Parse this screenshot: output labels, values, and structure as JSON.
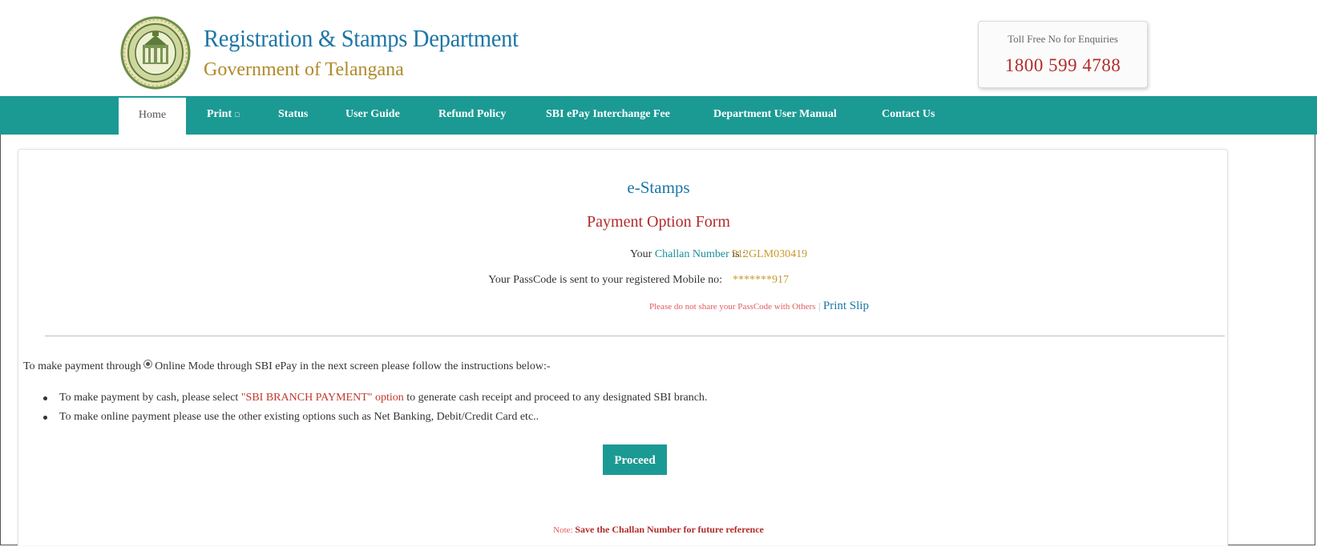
{
  "header": {
    "title": "Registration & Stamps Department",
    "subtitle": "Government of Telangana",
    "toll_label": "Toll Free No for Enquiries",
    "toll_number": "1800 599 4788",
    "logo_icon": "telangana-emblem-icon"
  },
  "nav": {
    "items": [
      {
        "label": "Home"
      },
      {
        "label": "Print",
        "caret": "□"
      },
      {
        "label": "Status"
      },
      {
        "label": "User Guide"
      },
      {
        "label": "Refund Policy"
      },
      {
        "label": "SBI ePay Interchange Fee"
      },
      {
        "label": "Department User Manual"
      },
      {
        "label": "Contact Us"
      }
    ],
    "active": "Home"
  },
  "main": {
    "heading": "e-Stamps",
    "form_title": "Payment Option Form",
    "challan": {
      "prefix": "Your ",
      "label": "Challan Number",
      "suffix": " is :",
      "value": "912GLM030419"
    },
    "passcode": {
      "label": "Your PassCode is sent to your registered Mobile no:",
      "value": "*******917"
    },
    "warning": "Please do not share your PassCode with Others",
    "separator": "|",
    "print_slip": "Print Slip",
    "intro_before": "To make payment through",
    "intro_after": "Online Mode through SBI ePay in the next screen please follow the instructions below:-",
    "bullet1_before": "To make payment by cash, please select ",
    "bullet1_highlight": "\"SBI BRANCH PAYMENT\" option",
    "bullet1_after": " to generate cash receipt and proceed to any designated SBI branch.",
    "bullet2": "To make online payment please use the other existing options such as Net Banking, Debit/Credit Card etc..",
    "proceed_label": "Proceed",
    "note_label": "Note:",
    "note_text": "Save the Challan Number for future reference"
  },
  "colors": {
    "teal": "#1b9a93",
    "title_blue": "#1d76a6",
    "gold": "#b08a2a",
    "red": "#b22b2b"
  }
}
